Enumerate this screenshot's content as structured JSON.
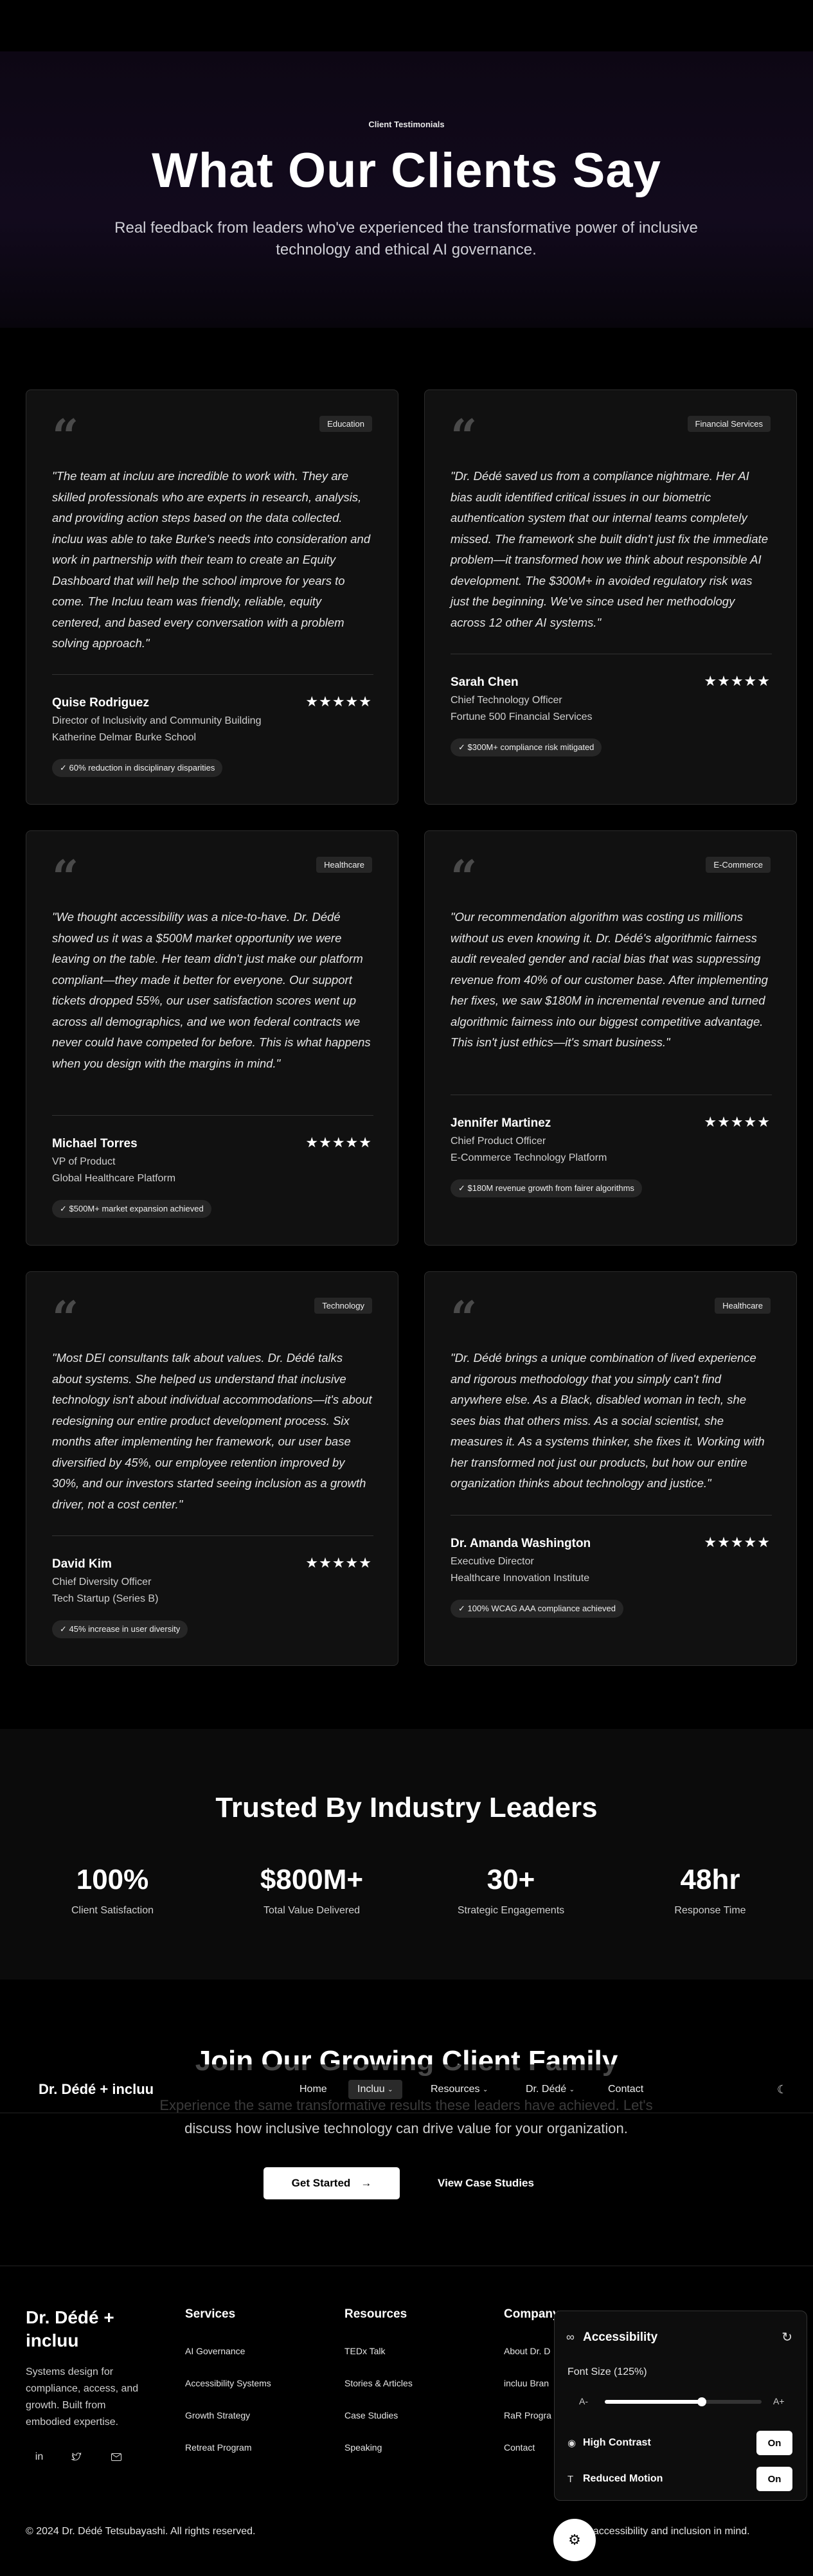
{
  "hero": {
    "eyebrow": "Client Testimonials",
    "title": "What Our Clients Say",
    "subtitle": "Real feedback from leaders who've experienced the transformative power of inclusive technology and ethical AI governance."
  },
  "testimonials": [
    {
      "category": "Education",
      "quote": "\"The team at incluu are incredible to work with. They are skilled professionals who are experts in research, analysis, and providing action steps based on the data collected. incluu was able to take Burke's needs into consideration and work in partnership with their team to create an Equity Dashboard that will help the school improve for years to come. The Incluu team was friendly, reliable, equity centered, and based every conversation with a problem solving approach.\"",
      "name": "Quise Rodriguez",
      "role": "Director of Inclusivity and Community Building",
      "org": "Katherine Delmar Burke School",
      "metric": "✓ 60% reduction in disciplinary disparities",
      "stars": "★★★★★"
    },
    {
      "category": "Financial Services",
      "quote": "\"Dr. Dédé saved us from a compliance nightmare. Her AI bias audit identified critical issues in our biometric authentication system that our internal teams completely missed. The framework she built didn't just fix the immediate problem—it transformed how we think about responsible AI development. The $300M+ in avoided regulatory risk was just the beginning. We've since used her methodology across 12 other AI systems.\"",
      "name": "Sarah Chen",
      "role": "Chief Technology Officer",
      "org": "Fortune 500 Financial Services",
      "metric": "✓ $300M+ compliance risk mitigated",
      "stars": "★★★★★"
    },
    {
      "category": "Healthcare",
      "quote": "\"We thought accessibility was a nice-to-have. Dr. Dédé showed us it was a $500M market opportunity we were leaving on the table. Her team didn't just make our platform compliant—they made it better for everyone. Our support tickets dropped 55%, our user satisfaction scores went up across all demographics, and we won federal contracts we never could have competed for before. This is what happens when you design with the margins in mind.\"",
      "name": "Michael Torres",
      "role": "VP of Product",
      "org": "Global Healthcare Platform",
      "metric": "✓ $500M+ market expansion achieved",
      "stars": "★★★★★"
    },
    {
      "category": "E-Commerce",
      "quote": "\"Our recommendation algorithm was costing us millions without us even knowing it. Dr. Dédé's algorithmic fairness audit revealed gender and racial bias that was suppressing revenue from 40% of our customer base. After implementing her fixes, we saw $180M in incremental revenue and turned algorithmic fairness into our biggest competitive advantage. This isn't just ethics—it's smart business.\"",
      "name": "Jennifer Martinez",
      "role": "Chief Product Officer",
      "org": "E-Commerce Technology Platform",
      "metric": "✓ $180M revenue growth from fairer algorithms",
      "stars": "★★★★★"
    },
    {
      "category": "Technology",
      "quote": "\"Most DEI consultants talk about values. Dr. Dédé talks about systems. She helped us understand that inclusive technology isn't about individual accommodations—it's about redesigning our entire product development process. Six months after implementing her framework, our user base diversified by 45%, our employee retention improved by 30%, and our investors started seeing inclusion as a growth driver, not a cost center.\"",
      "name": "David Kim",
      "role": "Chief Diversity Officer",
      "org": "Tech Startup (Series B)",
      "metric": "✓ 45% increase in user diversity",
      "stars": "★★★★★"
    },
    {
      "category": "Healthcare",
      "quote": "\"Dr. Dédé brings a unique combination of lived experience and rigorous methodology that you simply can't find anywhere else. As a Black, disabled woman in tech, she sees bias that others miss. As a social scientist, she measures it. As a systems thinker, she fixes it. Working with her transformed not just our products, but how our entire organization thinks about technology and justice.\"",
      "name": "Dr. Amanda Washington",
      "role": "Executive Director",
      "org": "Healthcare Innovation Institute",
      "metric": "✓ 100% WCAG AAA compliance achieved",
      "stars": "★★★★★"
    }
  ],
  "stats": {
    "title": "Trusted By Industry Leaders",
    "items": [
      {
        "value": "100%",
        "label": "Client Satisfaction"
      },
      {
        "value": "$800M+",
        "label": "Total Value Delivered"
      },
      {
        "value": "30+",
        "label": "Strategic Engagements"
      },
      {
        "value": "48hr",
        "label": "Response Time"
      }
    ]
  },
  "cta": {
    "title": "Join Our Growing Client Family",
    "subtitle": "Experience the same transformative results these leaders have achieved. Let's discuss how inclusive technology can drive value for your organization.",
    "primary": "Get Started",
    "secondary": "View Case Studies"
  },
  "nav": {
    "logo": "Dr. Dédé + incluu",
    "items": [
      "Home",
      "Incluu",
      "Resources",
      "Dr. Dédé",
      "Contact"
    ],
    "active_index": 1
  },
  "footer": {
    "brand": "Dr. Dédé + incluu",
    "description": "Systems design for compliance, access, and growth. Built from embodied expertise.",
    "columns": [
      {
        "title": "Services",
        "links": [
          "AI Governance",
          "Accessibility Systems",
          "Growth Strategy",
          "Retreat Program"
        ]
      },
      {
        "title": "Resources",
        "links": [
          "TEDx Talk",
          "Stories & Articles",
          "Case Studies",
          "Speaking"
        ]
      },
      {
        "title": "Company",
        "links": [
          "About Dr. D",
          "incluu Bran",
          "RaR Progra",
          "Contact"
        ]
      }
    ],
    "copyright": "© 2024 Dr. Dédé Tetsubayashi. All rights reserved.",
    "tagline": "with accessibility and inclusion in mind."
  },
  "a11y": {
    "title": "Accessibility",
    "font_size_label": "Font Size (125%)",
    "font_scale_fraction": 0.62,
    "small_label": "A-",
    "big_label": "A+",
    "high_contrast_label": "High Contrast",
    "high_contrast_state": "On",
    "reduced_motion_label": "Reduced Motion",
    "reduced_motion_state": "On"
  },
  "icons": {
    "quote": "quote-icon",
    "arrow": "arrow-right-icon",
    "theme": "moon-icon",
    "linkedin": "linkedin-icon",
    "twitter": "twitter-icon",
    "mail": "mail-icon",
    "reset": "reset-icon",
    "eye": "eye-icon",
    "text": "text-icon",
    "settings": "gear-icon"
  }
}
